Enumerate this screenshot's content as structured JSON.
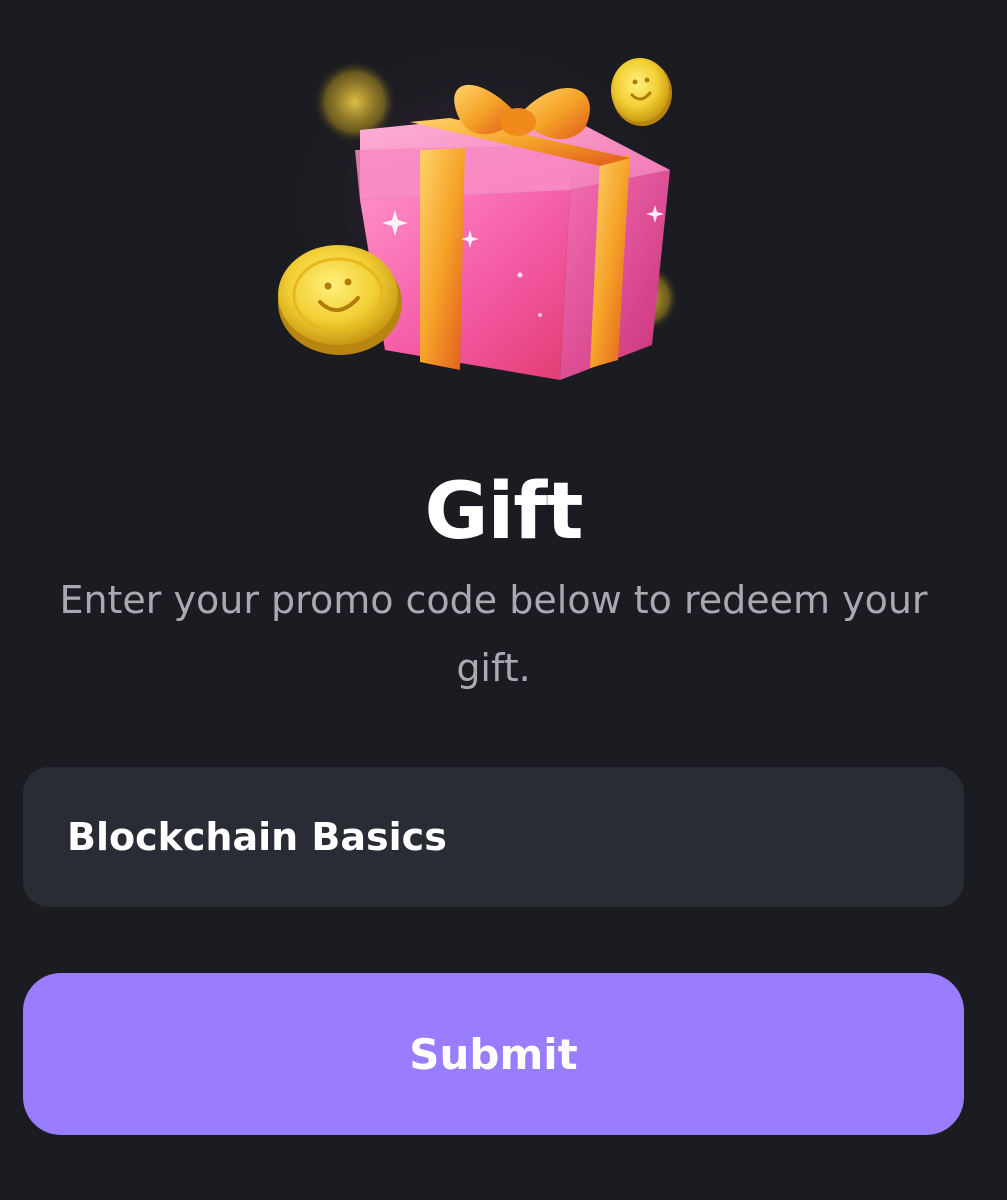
{
  "header": {
    "illustration_icon": "gift-box-with-coins-icon"
  },
  "gift": {
    "title": "Gift",
    "subtitle": "Enter your promo code below to redeem your gift."
  },
  "promo": {
    "value": "Blockchain Basics",
    "placeholder": ""
  },
  "actions": {
    "submit_label": "Submit"
  },
  "colors": {
    "background": "#1b1c21",
    "field_background": "#2a2c35",
    "subtitle_text": "#a8a9b2",
    "accent": "#9a7cff",
    "coin_gold": "#f2cf35",
    "gift_pink": "#f56fb3",
    "ribbon_orange": "#f5a329"
  }
}
